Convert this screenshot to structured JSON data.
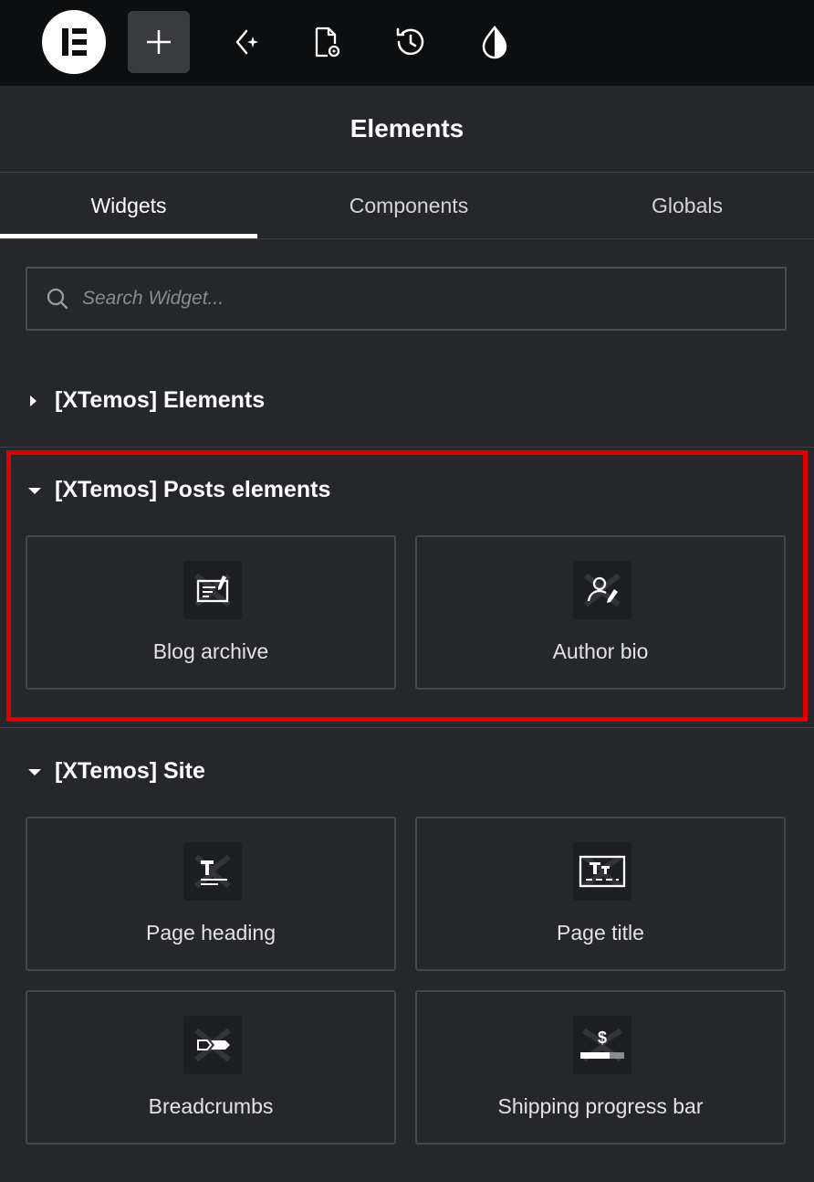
{
  "toolbar": {
    "items": [
      {
        "name": "elementor-logo",
        "icon": "elementor-logo"
      },
      {
        "name": "add-element",
        "icon": "plus-icon"
      },
      {
        "name": "ai-assistant",
        "icon": "sparkle-icon"
      },
      {
        "name": "page-settings",
        "icon": "page-settings-icon"
      },
      {
        "name": "history",
        "icon": "history-icon"
      },
      {
        "name": "site-settings",
        "icon": "droplet-icon"
      }
    ]
  },
  "panel": {
    "title": "Elements"
  },
  "tabs": [
    {
      "label": "Widgets",
      "active": true
    },
    {
      "label": "Components",
      "active": false
    },
    {
      "label": "Globals",
      "active": false
    }
  ],
  "search": {
    "placeholder": "Search Widget..."
  },
  "sections": [
    {
      "title": "[XTemos] Elements",
      "expanded": false,
      "widgets": []
    },
    {
      "title": "[XTemos] Posts elements",
      "expanded": true,
      "highlighted": true,
      "widgets": [
        {
          "label": "Blog archive",
          "icon": "blog-archive-icon"
        },
        {
          "label": "Author bio",
          "icon": "author-bio-icon"
        }
      ]
    },
    {
      "title": "[XTemos] Site",
      "expanded": true,
      "widgets": [
        {
          "label": "Page heading",
          "icon": "page-heading-icon"
        },
        {
          "label": "Page title",
          "icon": "page-title-icon"
        },
        {
          "label": "Breadcrumbs",
          "icon": "breadcrumbs-icon"
        },
        {
          "label": "Shipping progress bar",
          "icon": "shipping-progress-bar-icon"
        }
      ]
    }
  ],
  "colors": {
    "background": "#26272b",
    "topbar": "#0d0e10",
    "highlight": "#e00000",
    "text": "#ffffff"
  }
}
